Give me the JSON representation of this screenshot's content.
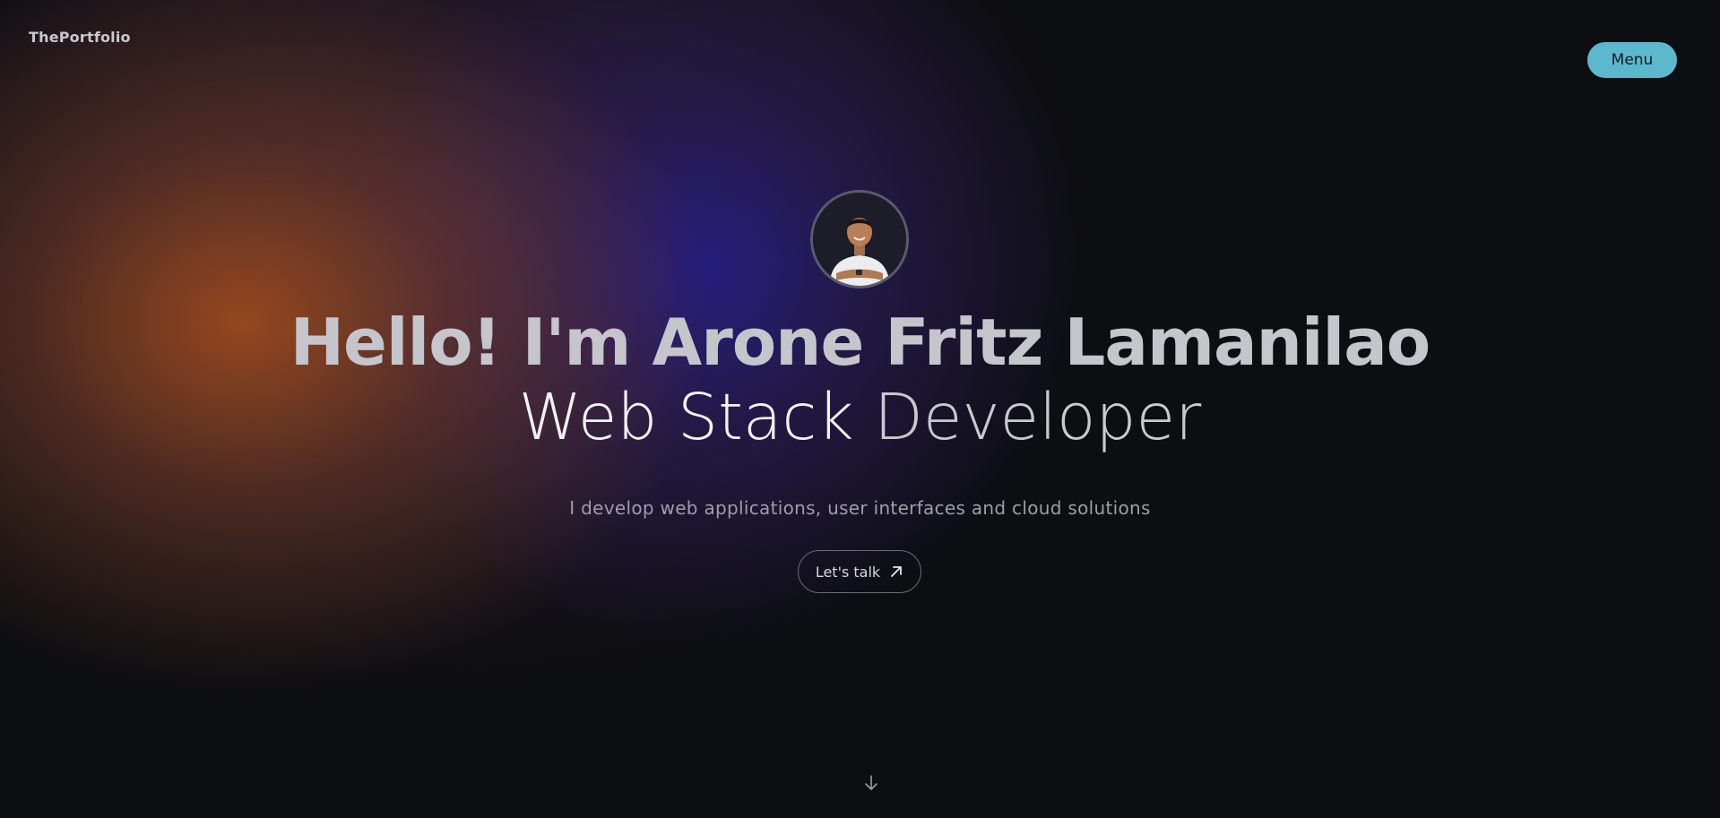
{
  "header": {
    "brand": "ThePortfolio",
    "menu_label": "Menu"
  },
  "hero": {
    "greeting": "Hello! I'm Arone Fritz Lamanilao",
    "role_part1": "Web Stack",
    "role_part2": "Developer",
    "tagline": "I develop web applications, user interfaces and cloud solutions",
    "cta_label": "Let's talk"
  },
  "icons": {
    "cta_icon": "arrow-up-right-icon",
    "scroll_icon": "arrow-down-icon"
  },
  "colors": {
    "menu_button": "#5cb8cc",
    "background": "#0d0e12",
    "glow_orange": "#aa501e",
    "glow_blue": "#281e8c"
  }
}
